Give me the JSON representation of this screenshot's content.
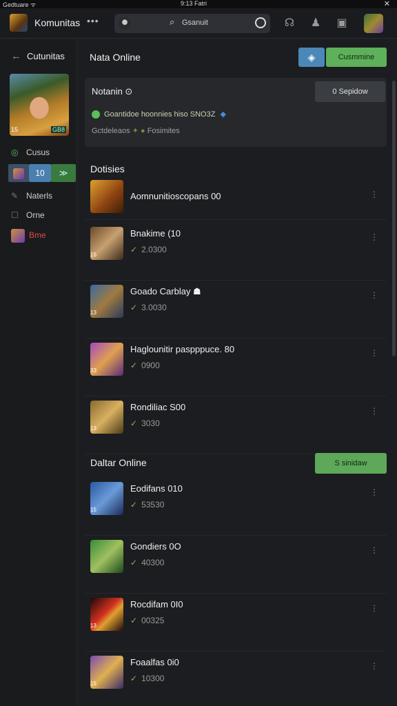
{
  "status_bar": {
    "left": "Gedtuare ᯤ",
    "center": "9:13 Fatri",
    "close": "✕"
  },
  "topbar": {
    "title": "Komunitas",
    "more": "•••",
    "search_placeholder": "Gsanuit",
    "search_icon": "search-icon"
  },
  "sidebar": {
    "back_label": "Cutunitas",
    "avatar_badge": "15",
    "avatar_badge2": "GB8",
    "items": [
      {
        "label": "Cusus",
        "icon": "ring-icon"
      },
      {
        "label": "Naterls",
        "icon": "feather-icon"
      },
      {
        "label": "Orne",
        "icon": "chat-icon"
      },
      {
        "label": "Bme",
        "icon": "thumb-icon"
      }
    ],
    "chips": [
      "",
      "10",
      "≫"
    ]
  },
  "main": {
    "header_title": "Nata Online",
    "header_icon_button": "◈",
    "header_action": "Cusmmine",
    "card": {
      "title": "Notanin ⊙",
      "button": "0 Sepidow",
      "line1": "Goantidoe hoonnies hiso SNO3Z",
      "line2_a": "Gctdeleaos",
      "line2_b": "Fosimites"
    },
    "section1_title": "Dotisies",
    "section2_title": "Daltar Online",
    "section2_button": "S sinidaw",
    "list1": [
      {
        "name": "Aomnunitioscopans 00",
        "stat": "",
        "lvl": ""
      },
      {
        "name": "Bnakime (10",
        "stat": "2.0300",
        "lvl": "15"
      },
      {
        "name": "Goado Carblay ☗",
        "stat": "3.0030",
        "lvl": "13"
      },
      {
        "name": "Haglounitir paspppuce. 80",
        "stat": "0900",
        "lvl": "33"
      },
      {
        "name": "Rondiliac S00",
        "stat": "3030",
        "lvl": "13"
      }
    ],
    "list2": [
      {
        "name": "Eodifans 010",
        "stat": "53530",
        "lvl": "15"
      },
      {
        "name": "Gondiers 0O",
        "stat": "40300",
        "lvl": ""
      },
      {
        "name": "Rocdifam 0I0",
        "stat": "00325",
        "lvl": "13"
      },
      {
        "name": "Foaalfas 0i0",
        "stat": "10300",
        "lvl": "15"
      }
    ]
  },
  "colors": {
    "accent_green": "#5fb05a",
    "accent_blue": "#4b88b8",
    "background": "#1c1d20",
    "danger": "#e04a4a"
  }
}
